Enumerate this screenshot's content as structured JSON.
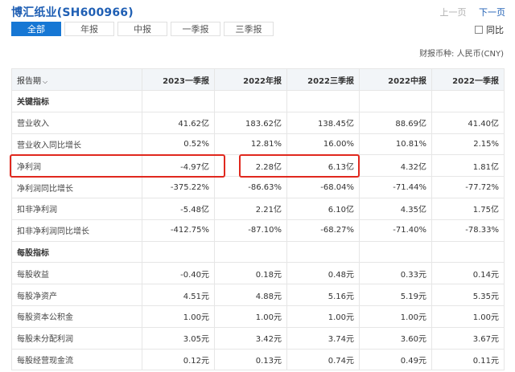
{
  "header": {
    "title": "博汇纸业(SH600966)",
    "prev_page": "上一页",
    "next_page": "下一页"
  },
  "tabs": [
    {
      "label": "全部",
      "active": true
    },
    {
      "label": "年报",
      "active": false
    },
    {
      "label": "中报",
      "active": false
    },
    {
      "label": "一季报",
      "active": false
    },
    {
      "label": "三季报",
      "active": false
    }
  ],
  "compare_label": "同比",
  "currency_label": "财报币种:",
  "currency_value": "人民币(CNY)",
  "table": {
    "period_header": "报告期",
    "columns": [
      "2023一季报",
      "2022年报",
      "2022三季报",
      "2022中报",
      "2022一季报"
    ],
    "rows": [
      {
        "label": "关键指标",
        "section": true,
        "values": [
          "",
          "",
          "",
          "",
          ""
        ]
      },
      {
        "label": "营业收入",
        "values": [
          "41.62亿",
          "183.62亿",
          "138.45亿",
          "88.69亿",
          "41.40亿"
        ]
      },
      {
        "label": "营业收入同比增长",
        "values": [
          "0.52%",
          "12.81%",
          "16.00%",
          "10.81%",
          "2.15%"
        ]
      },
      {
        "label": "净利润",
        "values": [
          "-4.97亿",
          "2.28亿",
          "6.13亿",
          "4.32亿",
          "1.81亿"
        ]
      },
      {
        "label": "净利润同比增长",
        "values": [
          "-375.22%",
          "-86.63%",
          "-68.04%",
          "-71.44%",
          "-77.72%"
        ]
      },
      {
        "label": "扣非净利润",
        "values": [
          "-5.48亿",
          "2.21亿",
          "6.10亿",
          "4.35亿",
          "1.75亿"
        ]
      },
      {
        "label": "扣非净利润同比增长",
        "values": [
          "-412.75%",
          "-87.10%",
          "-68.27%",
          "-71.40%",
          "-78.33%"
        ]
      },
      {
        "label": "每股指标",
        "section": true,
        "values": [
          "",
          "",
          "",
          "",
          ""
        ]
      },
      {
        "label": "每股收益",
        "values": [
          "-0.40元",
          "0.18元",
          "0.48元",
          "0.33元",
          "0.14元"
        ]
      },
      {
        "label": "每股净资产",
        "values": [
          "4.51元",
          "4.88元",
          "5.16元",
          "5.19元",
          "5.35元"
        ]
      },
      {
        "label": "每股资本公积金",
        "values": [
          "1.00元",
          "1.00元",
          "1.00元",
          "1.00元",
          "1.00元"
        ]
      },
      {
        "label": "每股未分配利润",
        "values": [
          "3.05元",
          "3.42元",
          "3.74元",
          "3.60元",
          "3.67元"
        ]
      },
      {
        "label": "每股经营现金流",
        "values": [
          "0.12元",
          "0.13元",
          "0.74元",
          "0.49元",
          "0.11元"
        ]
      }
    ]
  },
  "highlight_color": "#e0281e",
  "accent_color": "#1677d4"
}
